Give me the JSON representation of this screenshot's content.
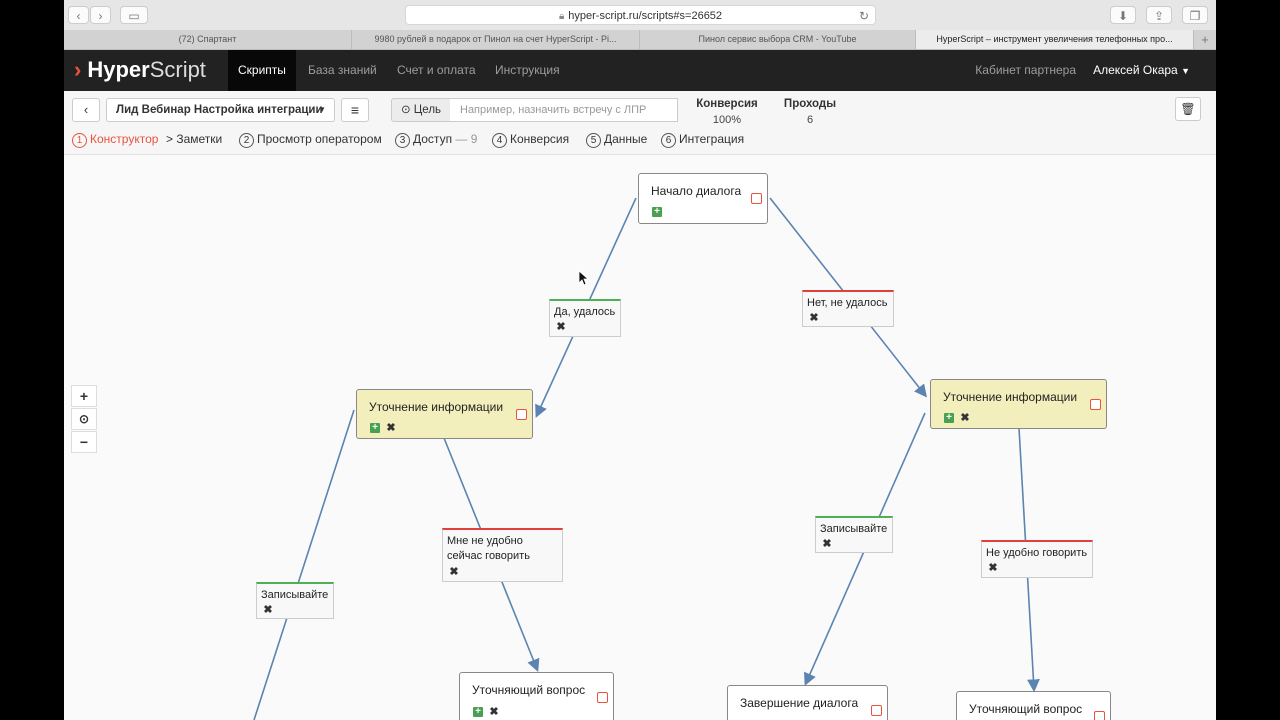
{
  "browser": {
    "url": "hyper-script.ru/scripts#s=26652",
    "tabs": [
      {
        "label": "(72) Спартант"
      },
      {
        "label": "9980 рублей в подарок от Пинол на счет HyperScript - Pi..."
      },
      {
        "label": "Пинол сервис выбора CRM - YouTube"
      },
      {
        "label": "HyperScript – инструмент увеличения телефонных про..."
      }
    ]
  },
  "header": {
    "logo_hyper": "Hyper",
    "logo_script": "Script",
    "nav": [
      {
        "label": "Скрипты"
      },
      {
        "label": "База знаний"
      },
      {
        "label": "Счет и оплата"
      },
      {
        "label": "Инструкция"
      }
    ],
    "partner": "Кабинет партнера",
    "user": "Алексей Окара"
  },
  "toolbar": {
    "script_name": "Лид Вебинар Настройка интеграции",
    "goal_label": "Цель",
    "goal_placeholder": "Например, назначить встречу с ЛПР",
    "conversion_label": "Конверсия",
    "conversion_value": "100%",
    "passes_label": "Проходы",
    "passes_value": "6"
  },
  "steps": [
    {
      "num": "1",
      "label": "Конструктор"
    },
    {
      "sep": ">",
      "label": "Заметки"
    },
    {
      "num": "2",
      "label": "Просмотр оператором"
    },
    {
      "num": "3",
      "label": "Доступ",
      "extra": "— 9"
    },
    {
      "num": "4",
      "label": "Конверсия"
    },
    {
      "num": "5",
      "label": "Данные"
    },
    {
      "num": "6",
      "label": "Интеграция"
    }
  ],
  "graph": {
    "nodes": {
      "start": "Начало диалога",
      "info_left": "Уточнение информации",
      "info_right": "Уточнение информации",
      "question_left": "Уточняющий вопрос",
      "finish": "Завершение диалога",
      "question_right": "Уточняющий вопрос"
    },
    "labels": {
      "yes": "Да, удалось",
      "no": "Нет, не удалось",
      "record_left": "Записывайте",
      "inconvenient_line1": "Мне не удобно",
      "inconvenient_line2": "сейчас говорить",
      "record_right": "Записывайте",
      "inconvenient_right": "Не удобно говорить"
    }
  },
  "zoom": {
    "in": "+",
    "center": "⊙",
    "out": "−"
  },
  "colors": {
    "accent": "#e8533f",
    "edge": "#5b84b1",
    "info_node": "#f3efbd",
    "yes": "#4bb056",
    "no": "#e0413c",
    "plus": "#4aa052"
  }
}
